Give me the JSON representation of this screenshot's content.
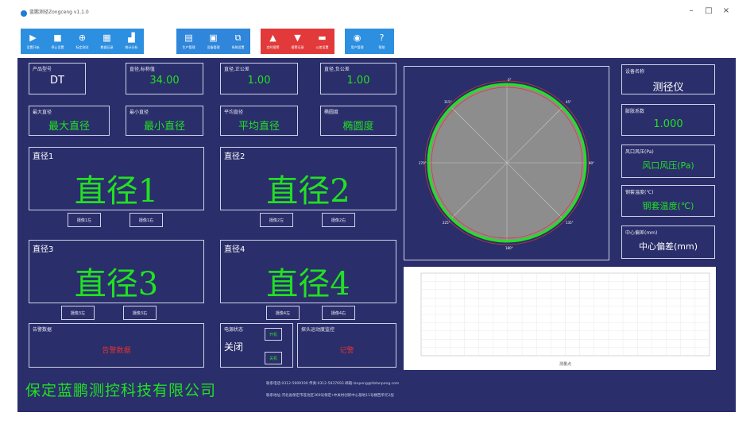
{
  "window": {
    "title": "蓝鹏测径Zongceng v1.1.0",
    "minimize": "–",
    "maximize": "□",
    "close": "×"
  },
  "toolbar": {
    "group1": [
      {
        "icon": "play-icon",
        "glyph": "▶",
        "label": "设置开始"
      },
      {
        "icon": "stop-icon",
        "glyph": "■",
        "label": "停止设置"
      },
      {
        "icon": "calibrate-icon",
        "glyph": "⊕",
        "label": "标定测试"
      },
      {
        "icon": "grid-icon",
        "glyph": "▦",
        "label": "数据记录"
      },
      {
        "icon": "chart-icon",
        "glyph": "▟",
        "label": "统计分析"
      }
    ],
    "group2": [
      {
        "icon": "product-manage-icon",
        "glyph": "▤",
        "label": "生产管理"
      },
      {
        "icon": "device-manage-icon",
        "glyph": "▣",
        "label": "设备管理"
      },
      {
        "icon": "system-settings-icon",
        "glyph": "⧉",
        "label": "系统设置"
      }
    ],
    "group3": [
      {
        "icon": "alarm-icon",
        "glyph": "▲",
        "label": "实时报警"
      },
      {
        "icon": "alarm-record-icon",
        "glyph": "▼",
        "label": "报警记录"
      },
      {
        "icon": "tolerance-icon",
        "glyph": "▬",
        "label": "公差设置"
      }
    ],
    "group4": [
      {
        "icon": "user-manage-icon",
        "glyph": "◉",
        "label": "用户管理"
      },
      {
        "icon": "help-icon",
        "glyph": "?",
        "label": "帮助"
      }
    ]
  },
  "top_panels": [
    {
      "label": "产品型号",
      "value": "DT",
      "green": false
    },
    {
      "label": "直径,标称值",
      "value": "34.00",
      "green": true
    },
    {
      "label": "直径,正公差",
      "value": "1.00",
      "green": true
    },
    {
      "label": "直径,负公差",
      "value": "1.00",
      "green": true
    }
  ],
  "stat_panels": [
    {
      "label": "最大直径",
      "value": "最大直径"
    },
    {
      "label": "最小直径",
      "value": "最小直径"
    },
    {
      "label": "平均直径",
      "value": "平均直径"
    },
    {
      "label": "椭圆度",
      "value": "椭圆度"
    }
  ],
  "diameters": [
    {
      "label": "直径1",
      "value": "直径1",
      "btn_left": "摄像1左",
      "btn_right": "摄像1右"
    },
    {
      "label": "直径2",
      "value": "直径2",
      "btn_left": "摄像2左",
      "btn_right": "摄像2右"
    },
    {
      "label": "直径3",
      "value": "直径3",
      "btn_left": "摄像3左",
      "btn_right": "摄像3右"
    },
    {
      "label": "直径4",
      "value": "直径4",
      "btn_left": "摄像4左",
      "btn_right": "摄像4右"
    }
  ],
  "alarm": {
    "label": "告警数据",
    "value": "告警数据"
  },
  "power": {
    "label": "电源状态",
    "value": "关闭",
    "on_btn": "开机",
    "off_btn": "关机"
  },
  "head_alarm": {
    "label": "探头运动度监控",
    "value": "记警"
  },
  "dial": {
    "labels": [
      "0°",
      "45°",
      "90°",
      "135°",
      "180°",
      "225°",
      "270°",
      "315°"
    ]
  },
  "right_panels": [
    {
      "label": "设备名称",
      "value": "测径仪",
      "green": false
    },
    {
      "label": "膨胀系数",
      "value": "1.000",
      "green": true
    },
    {
      "label": "风口风压(Pa)",
      "value": "风口风压(Pa)",
      "green": true
    },
    {
      "label": "钢套温度(℃)",
      "value": "钢套温度(℃)",
      "green": true
    },
    {
      "label": "中心偏差(mm)",
      "value": "中心偏差(mm)",
      "green": false
    }
  ],
  "chart_data": {
    "type": "line",
    "title": "",
    "xlabel": "测量点",
    "ylabel": "",
    "series": [],
    "grid": true
  },
  "footer": {
    "company": "保定蓝鹏测控科技有限公司",
    "contact": "联系电话:0312-5909190 传真:0312-5937693 邮箱:lanpeng@hblanpeng.com",
    "address": "联系地址:河北省保定市莲池区369号保定•中关村创新中心基地11号楼西单元2层"
  },
  "colors": {
    "background": "#2a2e6b",
    "value_green": "#22e022",
    "toolbar_blue": "#2d8fe0",
    "toolbar_red": "#e23a3a",
    "alarm_red": "#e23333"
  }
}
